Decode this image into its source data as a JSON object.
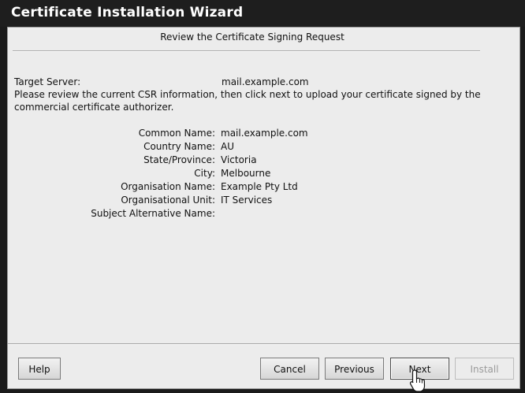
{
  "window": {
    "title": "Certificate Installation Wizard"
  },
  "header": {
    "title": "Review the Certificate Signing Request"
  },
  "target": {
    "label": "Target Server:",
    "value": "mail.example.com"
  },
  "intro": {
    "text": "Please review the current CSR information, then click next to upload your certificate signed by the commercial certificate authorizer."
  },
  "fields": [
    {
      "label": "Common Name:",
      "value": "mail.example.com"
    },
    {
      "label": "Country Name:",
      "value": "AU"
    },
    {
      "label": "State/Province:",
      "value": "Victoria"
    },
    {
      "label": "City:",
      "value": "Melbourne"
    },
    {
      "label": "Organisation Name:",
      "value": "Example Pty Ltd"
    },
    {
      "label": "Organisational Unit:",
      "value": "IT Services"
    },
    {
      "label": "Subject Alternative Name:",
      "value": ""
    }
  ],
  "buttons": {
    "help": "Help",
    "cancel": "Cancel",
    "previous": "Previous",
    "next": "Next",
    "install": "Install"
  },
  "state": {
    "install_enabled": false
  },
  "icons": {
    "pointer": "hand-pointer-icon"
  }
}
